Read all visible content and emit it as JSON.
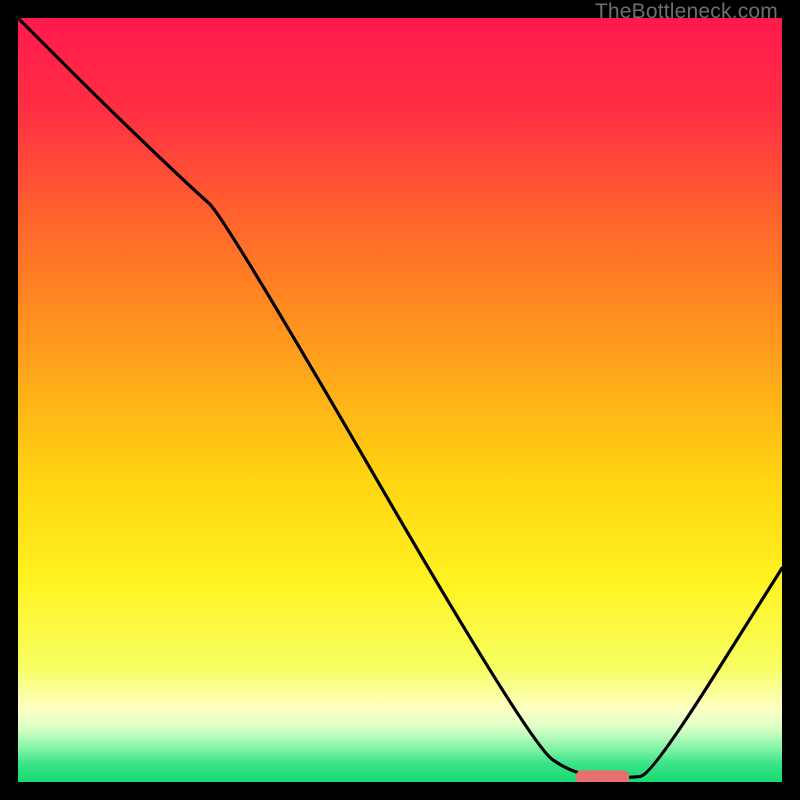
{
  "watermark": "TheBottleneck.com",
  "chart_data": {
    "type": "line",
    "title": "",
    "xlabel": "",
    "ylabel": "",
    "xlim": [
      0,
      100
    ],
    "ylim": [
      0,
      100
    ],
    "grid": false,
    "legend": false,
    "gradient_stops": [
      {
        "offset": 0.0,
        "color": "#ff1a4e"
      },
      {
        "offset": 0.12,
        "color": "#ff2e43"
      },
      {
        "offset": 0.28,
        "color": "#ff6a2a"
      },
      {
        "offset": 0.45,
        "color": "#ffa21b"
      },
      {
        "offset": 0.6,
        "color": "#ffd311"
      },
      {
        "offset": 0.74,
        "color": "#fff321"
      },
      {
        "offset": 0.85,
        "color": "#f7ff62"
      },
      {
        "offset": 0.905,
        "color": "#feffc4"
      },
      {
        "offset": 0.93,
        "color": "#d9ffc7"
      },
      {
        "offset": 0.955,
        "color": "#86f5a8"
      },
      {
        "offset": 0.975,
        "color": "#3de48a"
      },
      {
        "offset": 1.0,
        "color": "#17d96f"
      }
    ],
    "series": [
      {
        "name": "bottleneck-curve",
        "x": [
          0.0,
          12.0,
          23.0,
          27.0,
          67.0,
          73.0,
          80.0,
          83.0,
          100.0
        ],
        "y": [
          100.0,
          88.0,
          77.5,
          74.0,
          5.0,
          0.8,
          0.5,
          1.0,
          28.0
        ]
      }
    ],
    "marker": {
      "name": "sweet-spot",
      "x_range": [
        73,
        80
      ],
      "y": 0.6,
      "color": "#e96f6d"
    }
  }
}
